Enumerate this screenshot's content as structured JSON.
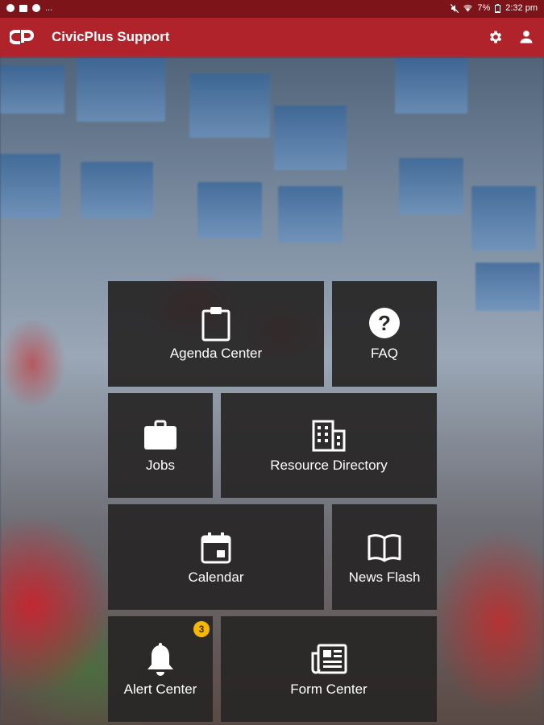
{
  "status_bar": {
    "overflow": "...",
    "battery": "7%",
    "time": "2:32 pm"
  },
  "app_bar": {
    "title": "CivicPlus Support",
    "logo": "civicplus-logo",
    "actions": [
      "gear-icon",
      "person-icon"
    ]
  },
  "tiles": [
    {
      "label": "Agenda Center",
      "icon": "clipboard-icon"
    },
    {
      "label": "FAQ",
      "icon": "help-circle-icon"
    },
    {
      "label": "Jobs",
      "icon": "briefcase-icon"
    },
    {
      "label": "Resource Directory",
      "icon": "building-icon"
    },
    {
      "label": "Calendar",
      "icon": "calendar-icon"
    },
    {
      "label": "News Flash",
      "icon": "book-open-icon"
    },
    {
      "label": "Alert Center",
      "icon": "bell-icon",
      "badge": "3"
    },
    {
      "label": "Form Center",
      "icon": "newspaper-icon"
    }
  ],
  "colors": {
    "status_bar": "#7c1419",
    "app_bar": "#b0232b",
    "tile": "#282626",
    "badge": "#f5b800"
  }
}
